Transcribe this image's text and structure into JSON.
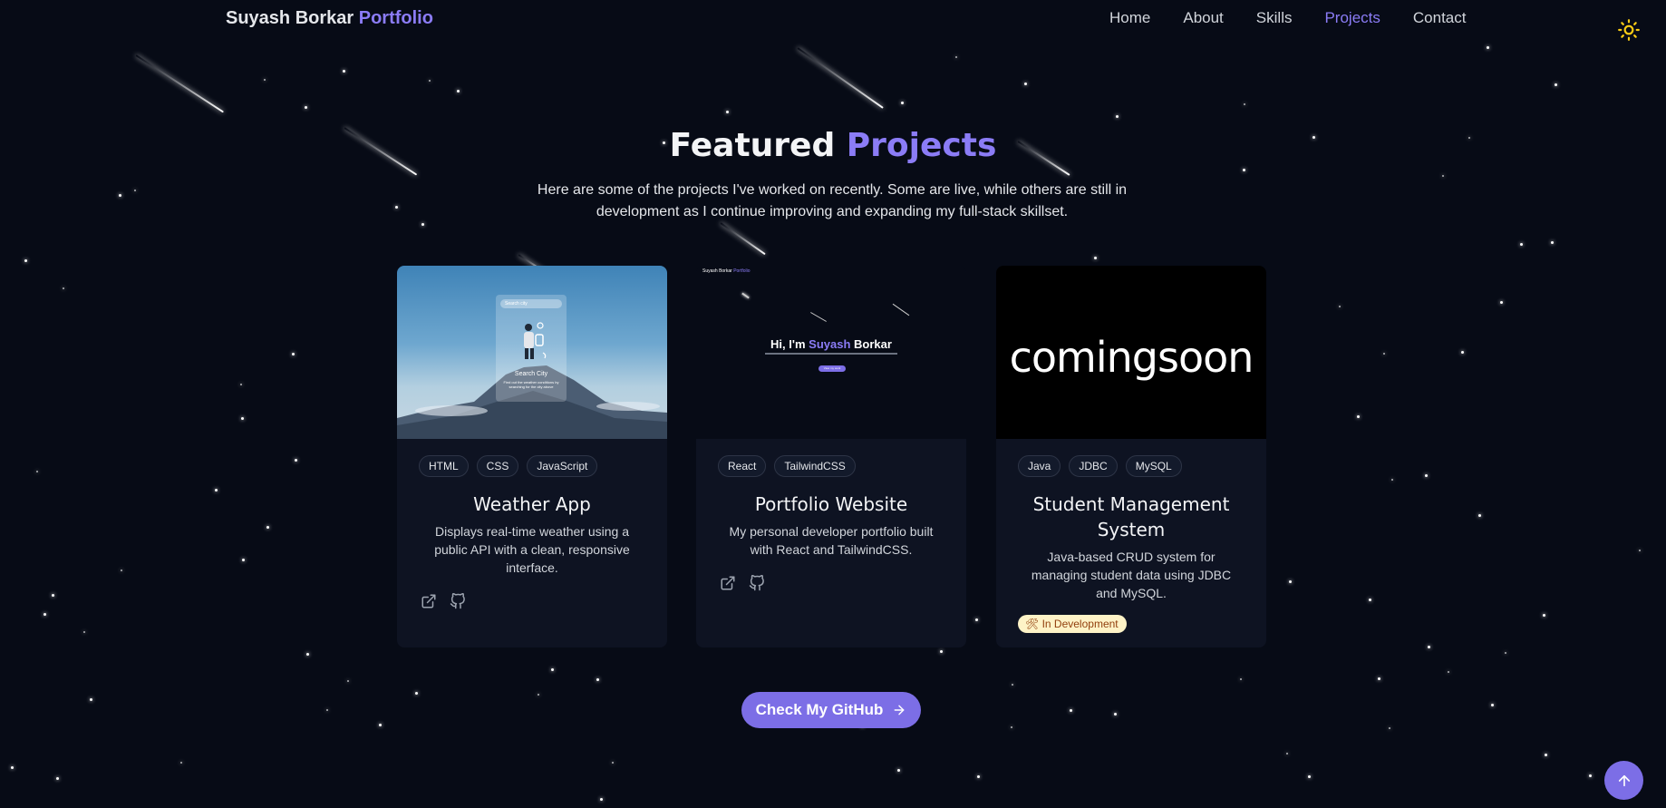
{
  "nav": {
    "brand_name": "Suyash Borkar",
    "brand_accent": "Portfolio",
    "links": [
      "Home",
      "About",
      "Skills",
      "Projects",
      "Contact"
    ],
    "active_link": "Projects",
    "theme_icon": "sun-icon"
  },
  "section": {
    "title_main": "Featured",
    "title_accent": "Projects",
    "description": "Here are some of the projects I've worked on recently. Some are live, while others are still in development as I continue improving and expanding my full-stack skillset."
  },
  "projects": [
    {
      "title": "Weather App",
      "description": "Displays real-time weather using a public API with a clean, responsive interface.",
      "tags": [
        "HTML",
        "CSS",
        "JavaScript"
      ],
      "image_text": {
        "search_placeholder": "Search city",
        "heading": "Search City",
        "caption": "Find out the weather conditions by searching for the city above"
      },
      "links": [
        "external-link-icon",
        "github-icon"
      ]
    },
    {
      "title": "Portfolio Website",
      "description": "My personal developer portfolio built with React and TailwindCSS.",
      "tags": [
        "React",
        "TailwindCSS"
      ],
      "image_text": {
        "nav_brand": "Suyash Borkar",
        "nav_accent": "Portfolio",
        "hero_pre": "Hi, I'm",
        "hero_accent": "Suyash",
        "hero_post": "Borkar",
        "button": "View my work"
      },
      "links": [
        "external-link-icon",
        "github-icon"
      ]
    },
    {
      "title": "Student Management System",
      "description": "Java-based CRUD system for managing student data using JDBC and MySQL.",
      "tags": [
        "Java",
        "JDBC",
        "MySQL"
      ],
      "image_text": {
        "placeholder": "comingsoon"
      },
      "status": "In Development",
      "status_icon": "hammer-wrench-icon"
    }
  ],
  "cta": {
    "label": "Check My GitHub",
    "icon": "arrow-right-icon"
  },
  "scroll_top": {
    "icon": "arrow-up-icon"
  },
  "colors": {
    "background": "#070b16",
    "accent": "#8b7cf6",
    "button": "#7c6ee6",
    "card": "#0e1322",
    "badge_bg": "#fef3c7"
  }
}
